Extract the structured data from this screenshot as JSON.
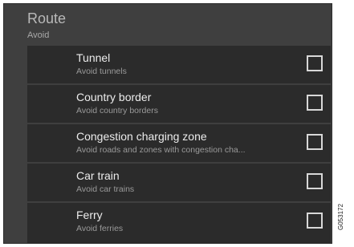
{
  "header": {
    "title": "Route",
    "subtitle": "Avoid"
  },
  "items": [
    {
      "label": "Tunnel",
      "description": "Avoid tunnels",
      "checked": false
    },
    {
      "label": "Country border",
      "description": "Avoid country borders",
      "checked": false
    },
    {
      "label": "Congestion charging zone",
      "description": "Avoid roads and zones with congestion cha...",
      "checked": false
    },
    {
      "label": "Car train",
      "description": "Avoid car trains",
      "checked": false
    },
    {
      "label": "Ferry",
      "description": "Avoid ferries",
      "checked": false
    }
  ],
  "image_reference": "G053172",
  "colors": {
    "screen_background": "#3f3f3f",
    "list_background": "#2b2b2b",
    "label_text": "#ececec",
    "description_text": "#9a9a9a",
    "checkbox_border": "#d8d8d8"
  }
}
